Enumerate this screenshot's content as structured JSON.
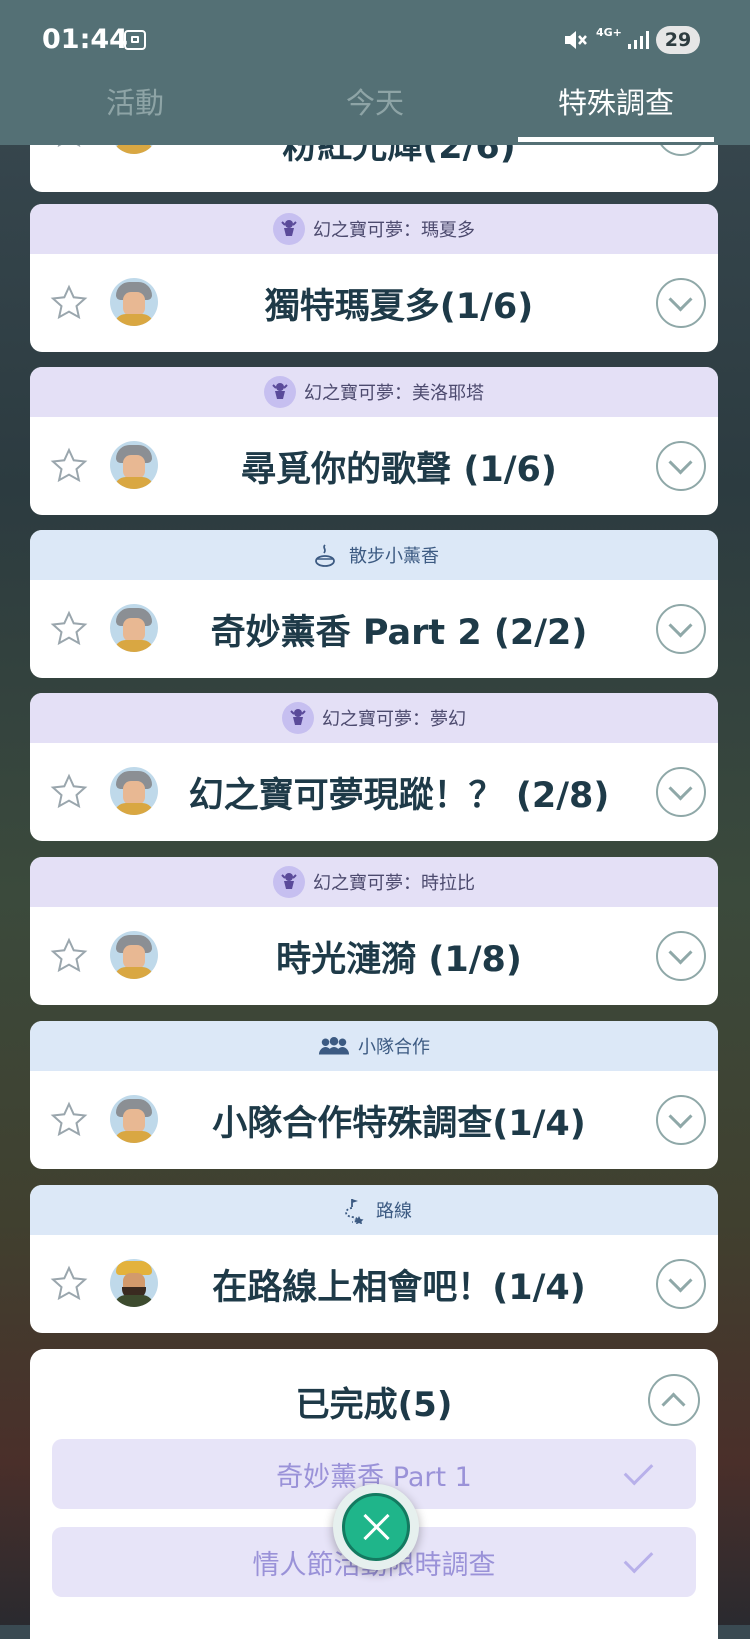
{
  "status_bar": {
    "time": "01:44",
    "network": "4G+",
    "battery": "29"
  },
  "tabs": [
    {
      "label": "活動",
      "active": false
    },
    {
      "label": "今天",
      "active": false
    },
    {
      "label": "特殊調查",
      "active": true
    }
  ],
  "partial_quest": {
    "title": "粉紅光輝(2/6)"
  },
  "quests": [
    {
      "category": "幻之寶可夢：瑪夏多",
      "category_icon": "mythical-pokemon-icon",
      "title": "獨特瑪夏多(1/6)",
      "mentor": "willow"
    },
    {
      "category": "幻之寶可夢：美洛耶塔",
      "category_icon": "mythical-pokemon-icon",
      "title": "尋覓你的歌聲 (1/6)",
      "mentor": "willow"
    },
    {
      "category": "散步小薰香",
      "category_icon": "incense-icon",
      "title": "奇妙薰香 Part 2 (2/2)",
      "mentor": "willow"
    },
    {
      "category": "幻之寶可夢：夢幻",
      "category_icon": "mythical-pokemon-icon",
      "title": "幻之寶可夢現蹤！？ (2/8)",
      "mentor": "willow"
    },
    {
      "category": "幻之寶可夢：時拉比",
      "category_icon": "mythical-pokemon-icon",
      "title": "時光漣漪 (1/8)",
      "mentor": "willow"
    },
    {
      "category": "小隊合作",
      "category_icon": "team-icon",
      "title": "小隊合作特殊調查(1/4)",
      "mentor": "willow"
    },
    {
      "category": "路線",
      "category_icon": "route-icon",
      "title": "在路線上相會吧！(1/4)",
      "mentor": "mateo"
    }
  ],
  "completed": {
    "title": "已完成(5)",
    "items": [
      "奇妙薰香 Part 1",
      "情人節活動限時調查"
    ]
  },
  "colors": {
    "header": "#547075",
    "title_text": "#1e3a48",
    "mythical_banner": "#e4e0f6",
    "info_banner": "#dce8f7",
    "fab": "#1fb58a"
  }
}
